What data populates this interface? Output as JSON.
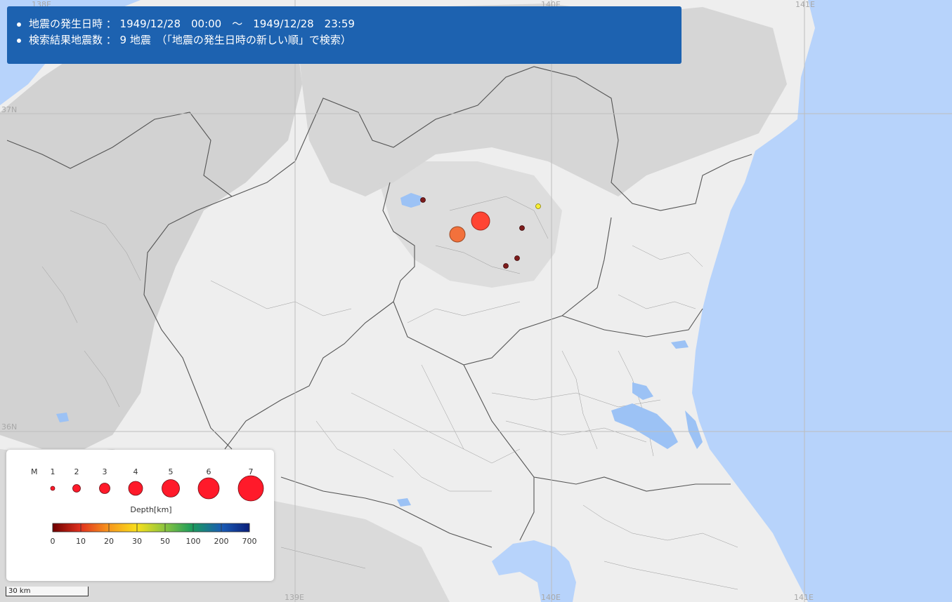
{
  "info": {
    "line1": "地震の発生日時 ： 1949/12/28　00:00　～　1949/12/28　23:59",
    "line2": "検索結果地震数 ： 9 地震　（「地震の発生日時の新しい順」で検索）"
  },
  "grid_labels": {
    "lon_138": "138E",
    "lon_140": "140E",
    "lon_141": "141E",
    "lat_37": "37N",
    "lat_36": "36N",
    "lon_139_bottom": "139E",
    "lon_140_bottom": "140E",
    "lon_141_bottom": "141E"
  },
  "legend": {
    "magnitude_title": "M",
    "magnitudes": [
      "1",
      "2",
      "3",
      "4",
      "5",
      "6",
      "7"
    ],
    "depth_title": "Depth[km]",
    "depth_ticks": [
      "0",
      "10",
      "20",
      "30",
      "50",
      "100",
      "200",
      "700"
    ],
    "depth_colors": [
      "#8b0000",
      "#e0301e",
      "#f7941d",
      "#f8e01c",
      "#8bc53f",
      "#1a9b5c",
      "#1a5bb5",
      "#0a1f7a"
    ]
  },
  "scale": {
    "label": "30 km"
  },
  "epicenter_colors": {
    "shallow": "#7d1b1b",
    "red": "#ff4433",
    "orange": "#f2713c",
    "yellow": "#f7ee34"
  },
  "earthquakes": [
    {
      "magnitude": 5.0,
      "color": "#ff4433"
    },
    {
      "magnitude": 4.2,
      "color": "#f2713c"
    },
    {
      "magnitude": 1.0,
      "color": "#7d1b1b"
    },
    {
      "magnitude": 1.0,
      "color": "#7d1b1b"
    },
    {
      "magnitude": 1.0,
      "color": "#7d1b1b"
    },
    {
      "magnitude": 1.0,
      "color": "#7d1b1b"
    },
    {
      "magnitude": 1.0,
      "color": "#f7ee34"
    }
  ]
}
